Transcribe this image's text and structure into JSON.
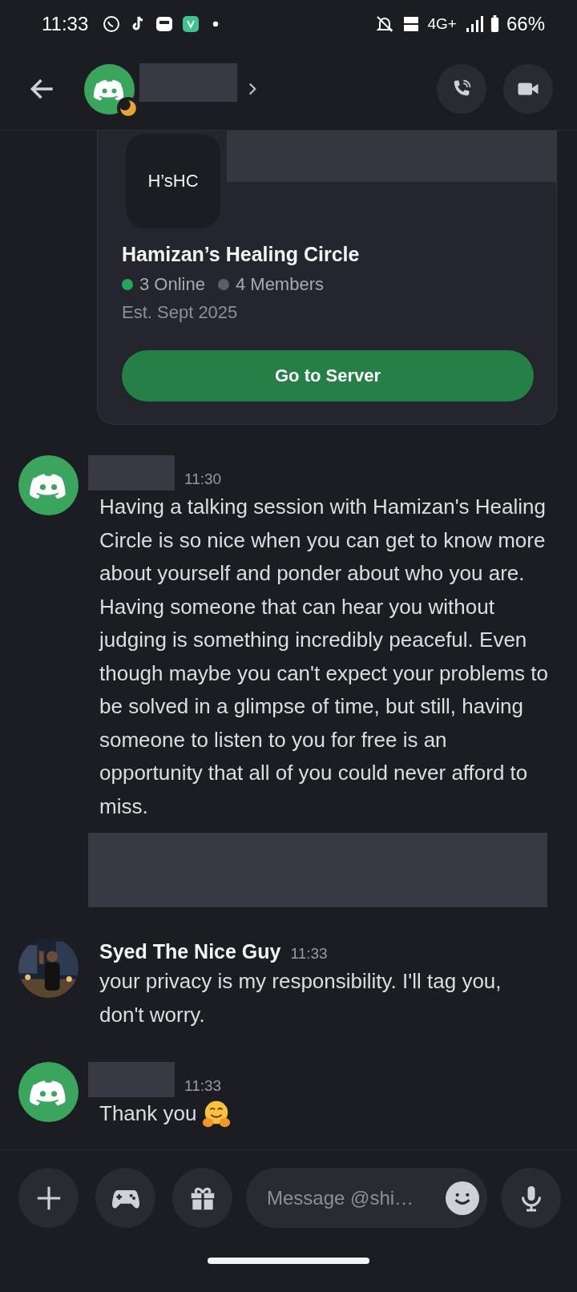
{
  "status_bar": {
    "time": "11:33",
    "network": "4G+",
    "battery": "66%"
  },
  "server_card": {
    "icon_text": "H’sHC",
    "name": "Hamizan’s Healing Circle",
    "online": "3 Online",
    "members": "4 Members",
    "established": "Est. Sept 2025",
    "button": "Go to Server"
  },
  "messages": [
    {
      "kind": "discord",
      "time": "11:30",
      "text": "Having a talking session with Hamizan's Healing Circle is so nice when you can get to know more about yourself and ponder about who you are. Having someone that can hear you without judging is something incredibly peaceful. Even though maybe you can't expect your problems to be solved in a glimpse of time, but still, having someone to listen to you for free is an opportunity that all of you could never afford to miss.",
      "attachment": true,
      "emoji": false
    },
    {
      "author": "Syed The Nice Guy",
      "time": "11:33",
      "text": "your privacy is my responsibility. I'll tag you, don't worry.",
      "attachment": false,
      "emoji": false
    },
    {
      "kind": "discord",
      "time": "11:33",
      "text": "Thank you",
      "attachment": false,
      "emoji": true
    }
  ],
  "composer": {
    "placeholder": "Message @shi…"
  }
}
